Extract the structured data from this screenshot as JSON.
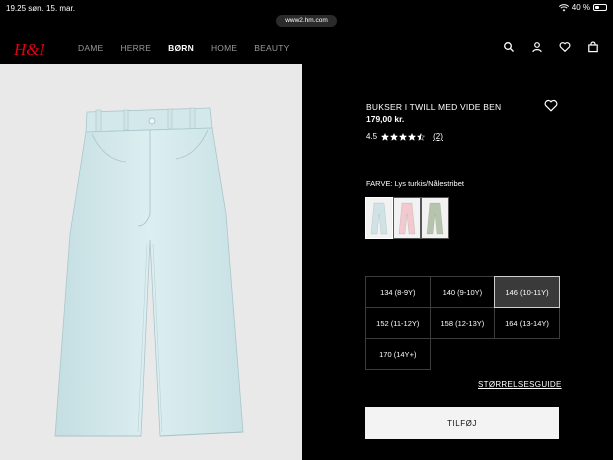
{
  "status_bar": {
    "time": "19.25",
    "date": "søn. 15. mar.",
    "battery": "40 %",
    "battery_level": 0.4
  },
  "browser": {
    "url": "www2.hm.com"
  },
  "brand": {
    "logo_text": "H&M",
    "logo_color": "#e50010"
  },
  "nav": {
    "items": [
      {
        "label": "DAME",
        "active": false
      },
      {
        "label": "HERRE",
        "active": false
      },
      {
        "label": "BØRN",
        "active": true
      },
      {
        "label": "HOME",
        "active": false
      },
      {
        "label": "BEAUTY",
        "active": false
      }
    ],
    "icons": [
      "search-icon",
      "account-icon",
      "favorites-icon",
      "bag-icon"
    ]
  },
  "product": {
    "title": "BUKSER I TWILL MED VIDE BEN",
    "price": "179,00 kr.",
    "rating": "4.5",
    "rating_value": 4.5,
    "reviews": "(2)",
    "color_label": "FARVE: Lys turkis/Nålestribet",
    "swatches": [
      {
        "color": "#cfe3e6",
        "selected": true
      },
      {
        "color": "#f1c9cf",
        "selected": false
      },
      {
        "color": "#b7c4ad",
        "selected": false
      }
    ],
    "sizes": [
      {
        "label": "134 (8-9Y)",
        "selected": false
      },
      {
        "label": "140 (9-10Y)",
        "selected": false
      },
      {
        "label": "146 (10-11Y)",
        "selected": true
      },
      {
        "label": "152 (11-12Y)",
        "selected": false
      },
      {
        "label": "158 (12-13Y)",
        "selected": false
      },
      {
        "label": "164 (13-14Y)",
        "selected": false
      },
      {
        "label": "170 (14Y+)",
        "selected": false
      }
    ],
    "size_guide": "STØRRELSESGUIDE",
    "add_button": "TILFØJ"
  }
}
